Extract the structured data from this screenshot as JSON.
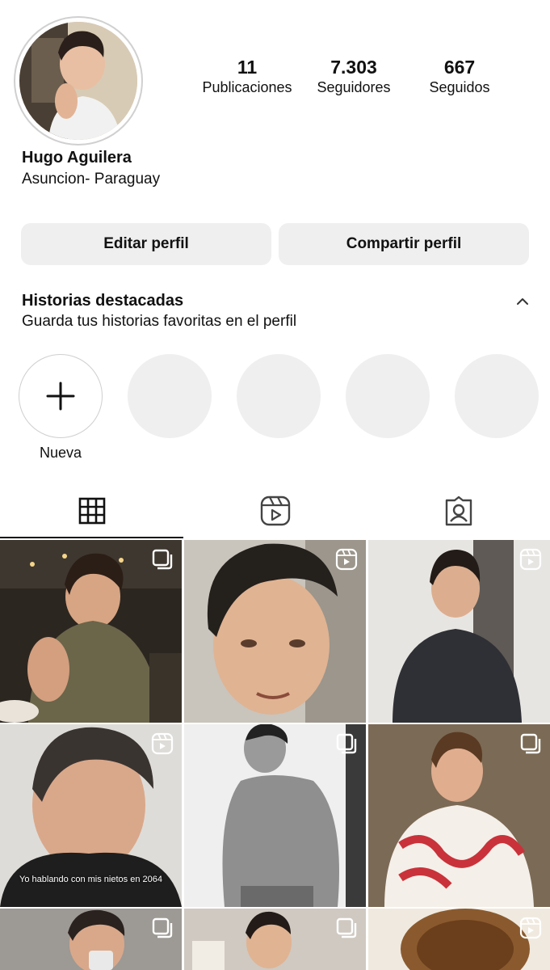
{
  "profile": {
    "name": "Hugo Aguilera",
    "bio": "Asuncion- Paraguay",
    "stats": [
      {
        "value": "11",
        "label": "Publicaciones"
      },
      {
        "value": "7.303",
        "label": "Seguidores"
      },
      {
        "value": "667",
        "label": "Seguidos"
      }
    ]
  },
  "buttons": {
    "edit": "Editar perfil",
    "share": "Compartir perfil"
  },
  "highlights": {
    "title": "Historias destacadas",
    "subtitle": "Guarda tus historias favoritas en el perfil",
    "new_label": "Nueva"
  },
  "tabs": [
    "grid-icon",
    "reels-icon",
    "tagged-icon"
  ],
  "posts": [
    {
      "badge": "carousel",
      "caption": ""
    },
    {
      "badge": "reel",
      "caption": ""
    },
    {
      "badge": "reel",
      "caption": ""
    },
    {
      "badge": "reel",
      "caption": "Yo hablando con mis nietos en 2064"
    },
    {
      "badge": "carousel",
      "caption": ""
    },
    {
      "badge": "carousel",
      "caption": ""
    },
    {
      "badge": "carousel",
      "caption": ""
    },
    {
      "badge": "carousel",
      "caption": ""
    },
    {
      "badge": "reel",
      "caption": ""
    }
  ]
}
